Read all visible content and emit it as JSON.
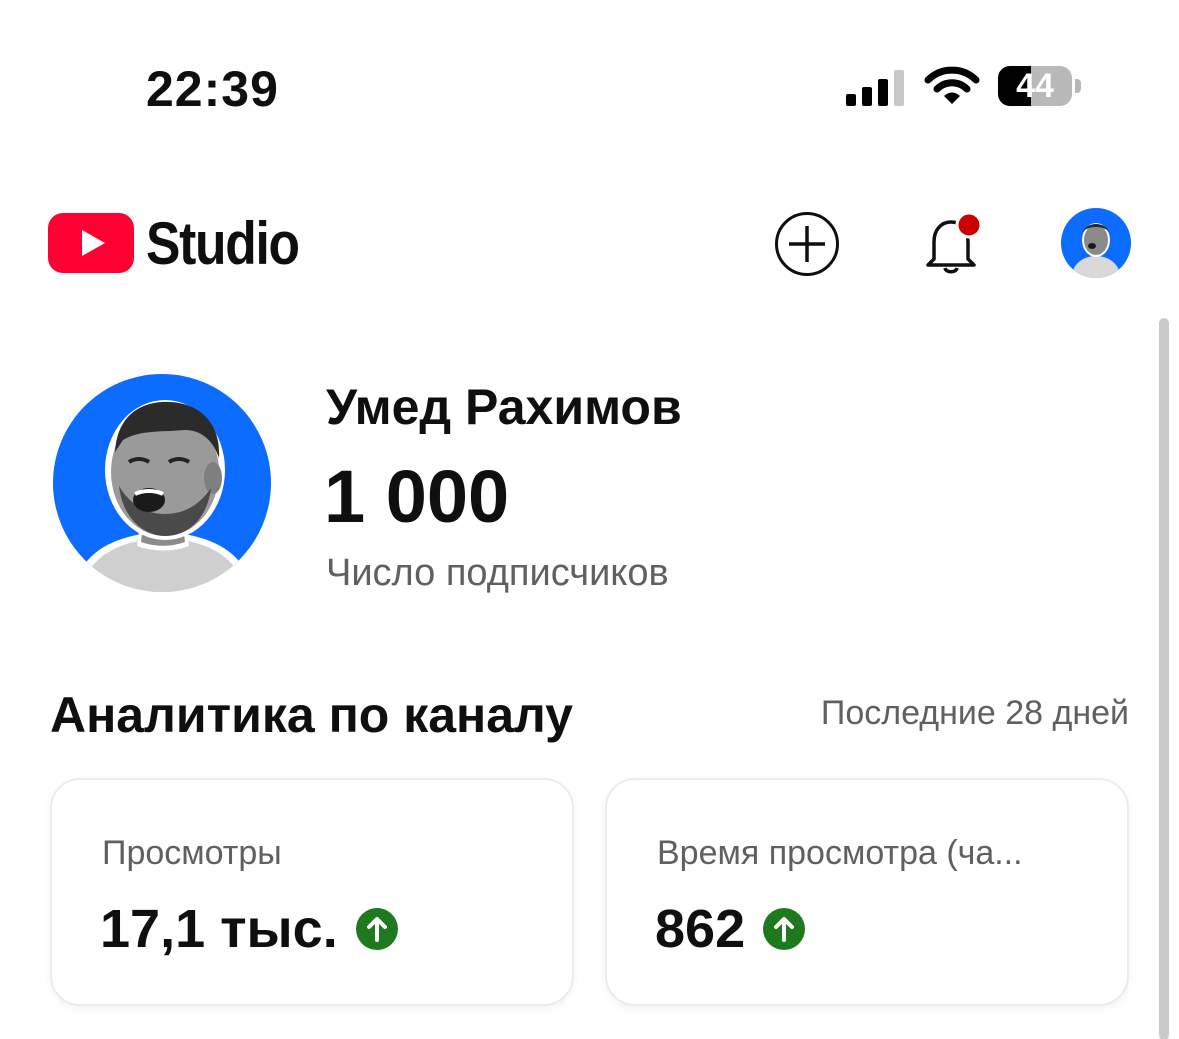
{
  "status_bar": {
    "time": "22:39",
    "battery_level": "44",
    "battery_fraction": 0.44,
    "icons": [
      "cellular-signal-icon",
      "wifi-icon",
      "battery-icon"
    ]
  },
  "header": {
    "logo_text": "Studio",
    "brand_color": "#ff0000",
    "notification_dot_color": "#cc0000",
    "icons": [
      "youtube-play-icon",
      "plus-circle-icon",
      "bell-icon",
      "account-avatar"
    ]
  },
  "channel": {
    "name": "Умед Рахимов",
    "subscriber_count": "1 000",
    "subscriber_label": "Число подписчиков",
    "avatar_bg_color": "#0b6cff"
  },
  "analytics": {
    "title": "Аналитика по каналу",
    "period": "Последние 28 дней",
    "cards": [
      {
        "label": "Просмотры",
        "value": "17,1 тыс.",
        "trend": "up",
        "trend_icon": "arrow-up-circle-icon"
      },
      {
        "label": "Время просмотра (ча...",
        "value": "862",
        "trend": "up",
        "trend_icon": "arrow-up-circle-icon"
      }
    ],
    "trend_up_color": "#1f7a1f"
  }
}
